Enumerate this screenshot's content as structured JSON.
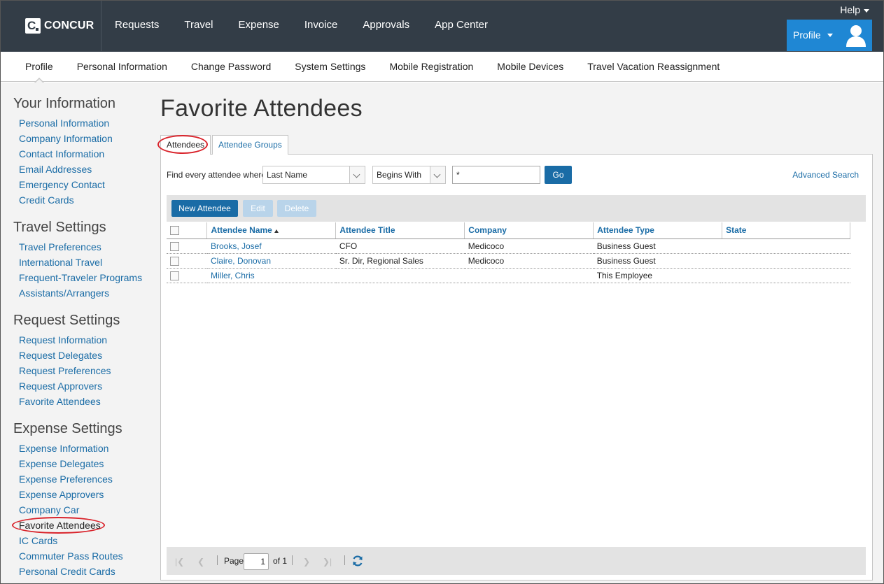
{
  "app": {
    "logo_text": "CONCUR",
    "help_label": "Help",
    "profile_label": "Profile"
  },
  "topnav": [
    {
      "label": "Requests"
    },
    {
      "label": "Travel"
    },
    {
      "label": "Expense"
    },
    {
      "label": "Invoice"
    },
    {
      "label": "Approvals"
    },
    {
      "label": "App Center"
    }
  ],
  "subnav": [
    {
      "label": "Profile"
    },
    {
      "label": "Personal Information"
    },
    {
      "label": "Change Password"
    },
    {
      "label": "System Settings"
    },
    {
      "label": "Mobile Registration"
    },
    {
      "label": "Mobile Devices"
    },
    {
      "label": "Travel Vacation Reassignment"
    }
  ],
  "sidebar": {
    "sections": [
      {
        "title": "Your Information",
        "items": [
          "Personal Information",
          "Company Information",
          "Contact Information",
          "Email Addresses",
          "Emergency Contact",
          "Credit Cards"
        ]
      },
      {
        "title": "Travel Settings",
        "items": [
          "Travel Preferences",
          "International Travel",
          "Frequent-Traveler Programs",
          "Assistants/Arrangers"
        ]
      },
      {
        "title": "Request Settings",
        "items": [
          "Request Information",
          "Request Delegates",
          "Request Preferences",
          "Request Approvers",
          "Favorite Attendees"
        ]
      },
      {
        "title": "Expense Settings",
        "items": [
          "Expense Information",
          "Expense Delegates",
          "Expense Preferences",
          "Expense Approvers",
          "Company Car",
          "Favorite Attendees",
          "IC Cards",
          "Commuter Pass Routes",
          "Personal Credit Cards"
        ]
      }
    ]
  },
  "main": {
    "title": "Favorite Attendees",
    "tabs": [
      {
        "label": "Attendees",
        "active": true
      },
      {
        "label": "Attendee Groups",
        "active": false
      }
    ],
    "search": {
      "label": "Find every attendee where",
      "field_value": "Last Name",
      "operator_value": "Begins With",
      "query_value": "*",
      "go_label": "Go",
      "advanced_label": "Advanced Search"
    },
    "toolbar": {
      "new_label": "New Attendee",
      "edit_label": "Edit",
      "delete_label": "Delete"
    },
    "table": {
      "columns": [
        "Attendee Name",
        "Attendee Title",
        "Company",
        "Attendee Type",
        "State"
      ],
      "rows": [
        {
          "name": "Brooks, Josef",
          "title": "CFO",
          "company": "Medicoco",
          "type": "Business Guest",
          "state": ""
        },
        {
          "name": "Claire, Donovan",
          "title": "Sr. Dir, Regional Sales",
          "company": "Medicoco",
          "type": "Business Guest",
          "state": ""
        },
        {
          "name": "Miller, Chris",
          "title": "",
          "company": "",
          "type": "This Employee",
          "state": ""
        }
      ]
    },
    "pager": {
      "page_label": "Page",
      "page_value": "1",
      "of_label": "of 1"
    }
  },
  "colors": {
    "topbar": "#333d47",
    "accent": "#1f87d4",
    "link": "#1a6ca6",
    "highlight_circle": "#d9232b"
  }
}
